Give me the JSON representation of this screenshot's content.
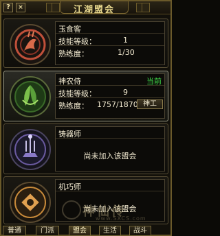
{
  "window": {
    "title": "江湖盟会",
    "help_label": "?",
    "close_label": "×"
  },
  "guilds": [
    {
      "name": "玉食客",
      "skill_label": "技能等级：",
      "skill_value": "1",
      "proficiency_label": "熟练度：",
      "proficiency_value": "1/30",
      "emblem_color": "#c0503a"
    },
    {
      "name": "神农侍",
      "status": "当前",
      "skill_label": "技能等级：",
      "skill_value": "9",
      "proficiency_label": "熟练度：",
      "proficiency_value": "1757/1870",
      "action_label": "神工",
      "emblem_color": "#5a9a3a"
    },
    {
      "name": "铸器师",
      "message": "尚未加入该盟会",
      "emblem_color": "#6a5aa0"
    },
    {
      "name": "机巧师",
      "message": "尚未加入该盟会",
      "emblem_color": "#c88a3a"
    }
  ],
  "tabs": [
    {
      "label": "普通"
    },
    {
      "label": "门派"
    },
    {
      "label": "盟会"
    },
    {
      "label": "生活"
    },
    {
      "label": "战斗"
    }
  ],
  "watermark": {
    "text": "神仙传",
    "sub": "www.SXCS.com"
  },
  "colors": {
    "border": "#6b5a2a",
    "title": "#e9d98e",
    "status_green": "#3fdc4a"
  }
}
